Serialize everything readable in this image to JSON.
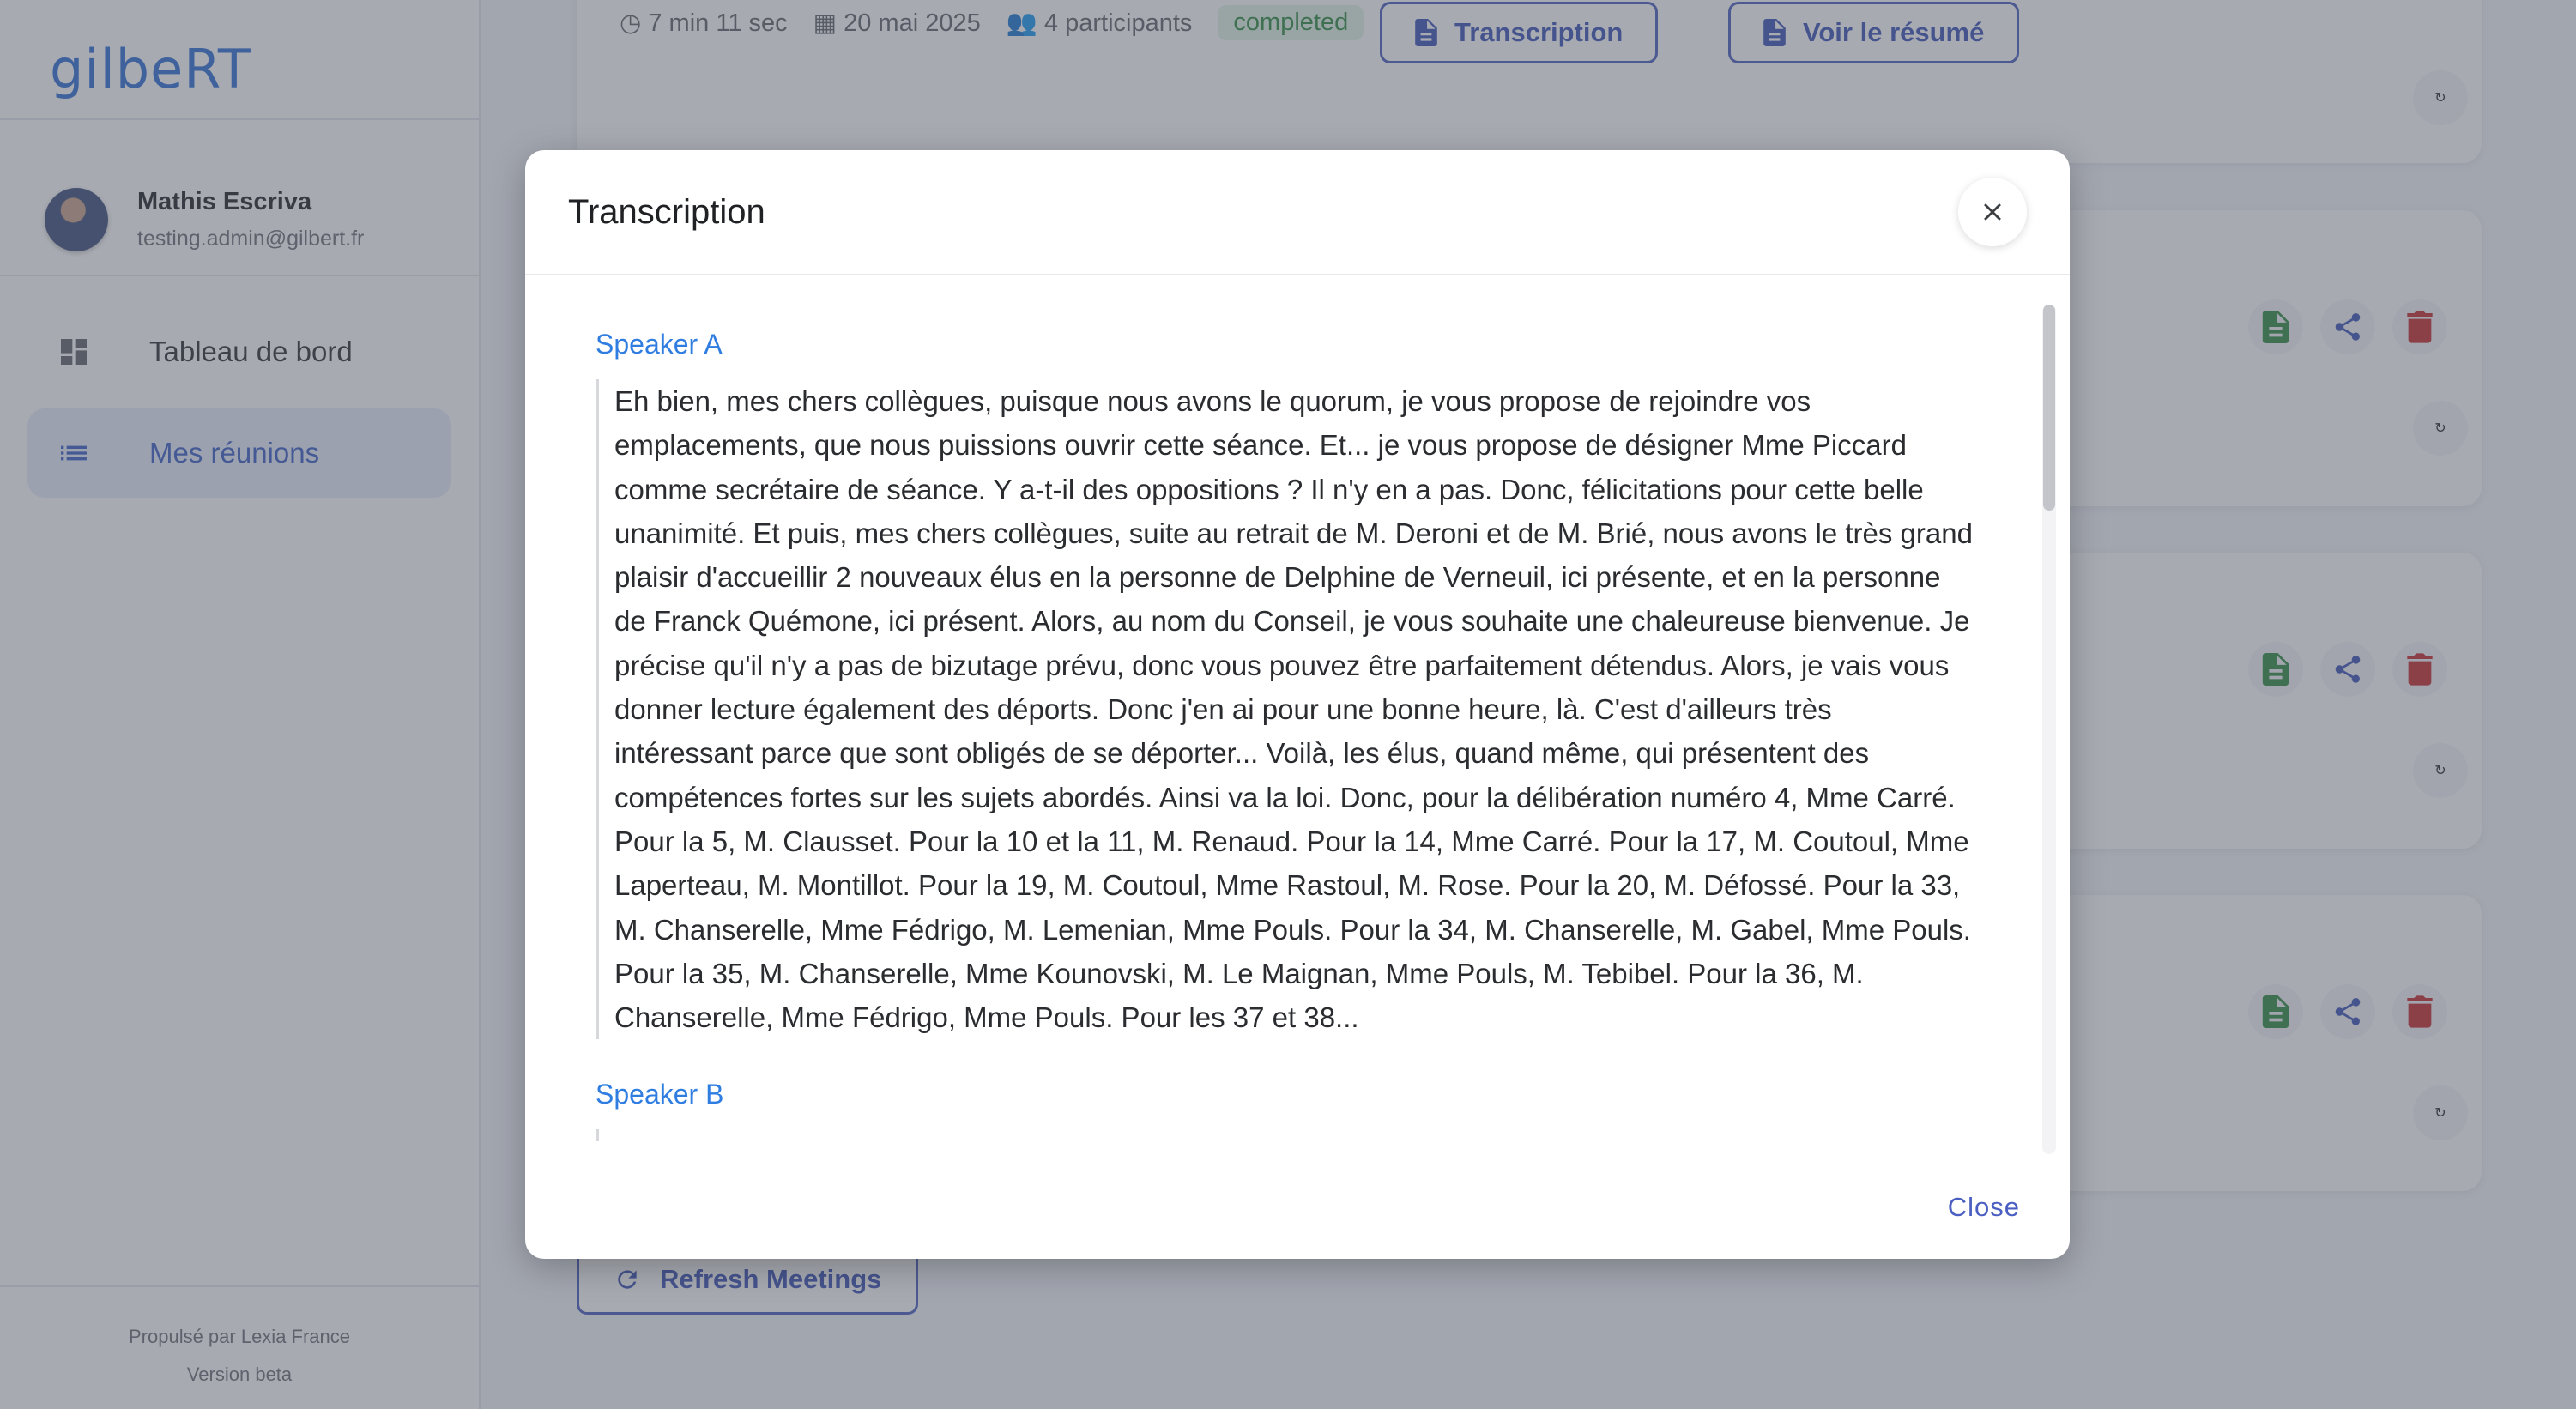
{
  "app": {
    "logo": "gilbeRT"
  },
  "user": {
    "name": "Mathis Escriva",
    "email": "testing.admin@gilbert.fr"
  },
  "nav": [
    {
      "label": "Tableau de bord",
      "icon": "dashboard-icon"
    },
    {
      "label": "Mes réunions",
      "icon": "list-icon",
      "active": true
    }
  ],
  "footer": {
    "powered_by": "Propulsé par Lexia France",
    "version": "Version beta"
  },
  "meeting": {
    "duration": "7 min 11 sec",
    "date": "20 mai 2025",
    "participants": "4 participants",
    "status": "completed",
    "transcription_button": "Transcription",
    "summary_button": "Voir le résumé"
  },
  "refresh_button": "Refresh Meetings",
  "colors": {
    "accent": "#4a5fc1",
    "speaker": "#2f7de1",
    "doc_green": "#2c8a3f",
    "delete_red": "#c62828"
  },
  "dialog": {
    "title": "Transcription",
    "close_label": "Close",
    "segments": [
      {
        "speaker": "Speaker A",
        "text": "Eh bien, mes chers collègues, puisque nous avons le quorum, je vous propose de rejoindre vos emplacements, que nous puissions ouvrir cette séance. Et... je vous propose de désigner Mme Piccard comme secrétaire de séance. Y a-t-il des oppositions ? Il n'y en a pas. Donc, félicitations pour cette belle unanimité. Et puis, mes chers collègues, suite au retrait de M. Deroni et de M. Brié, nous avons le très grand plaisir d'accueillir 2 nouveaux élus en la personne de Delphine de Verneuil, ici présente, et en la personne de Franck Quémone, ici présent. Alors, au nom du Conseil, je vous souhaite une chaleureuse bienvenue. Je précise qu'il n'y a pas de bizutage prévu, donc vous pouvez être parfaitement détendus. Alors, je vais vous donner lecture également des déports. Donc j'en ai pour une bonne heure, là. C'est d'ailleurs très intéressant parce que sont obligés de se déporter... Voilà, les élus, quand même, qui présentent des compétences fortes sur les sujets abordés. Ainsi va la loi. Donc, pour la délibération numéro 4, Mme Carré. Pour la 5, M. Clausset. Pour la 10 et la 11, M. Renaud. Pour la 14, Mme Carré. Pour la 17, M. Coutoul, Mme Laperteau, M. Montillot. Pour la 19, M. Coutoul, Mme Rastoul, M. Rose. Pour la 20, M. Défossé. Pour la 33, M. Chanserelle, Mme Fédrigo, M. Lemenian, Mme Pouls. Pour la 34, M. Chanserelle, M. Gabel, Mme Pouls. Pour la 35, M. Chanserelle, Mme Kounovski, M. Le Maignan, Mme Pouls, M. Tebibel. Pour la 36, M. Chanserelle, Mme Fédrigo, Mme Pouls. Pour les 37 et 38..."
      },
      {
        "speaker": "Speaker B",
        "text": ""
      }
    ]
  }
}
